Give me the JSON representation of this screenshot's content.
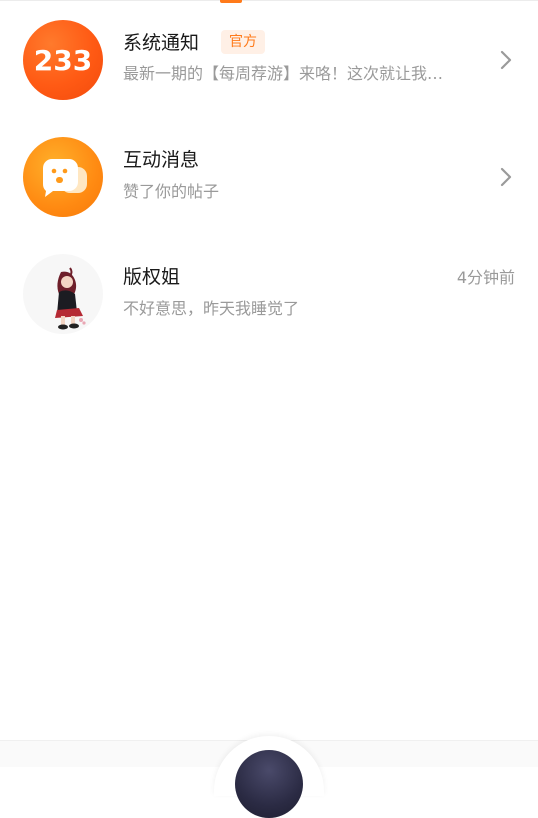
{
  "messages": [
    {
      "title": "系统通知",
      "badge": "官方",
      "subtitle": "最新一期的【每周荐游】来咯！这次就让我…",
      "avatar_text": "233",
      "avatar_icon": "233-logo-icon",
      "has_chevron": true
    },
    {
      "title": "互动消息",
      "subtitle": "赞了你的帖子",
      "avatar_icon": "chat-bubbles-icon",
      "has_chevron": true
    },
    {
      "title": "版权姐",
      "subtitle": "不好意思，昨天我睡觉了",
      "time": "4分钟前",
      "avatar_icon": "anime-girl-avatar"
    }
  ],
  "colors": {
    "accent": "#ff7a1a",
    "system_avatar": "#ff5a14",
    "interaction_avatar": "#ff8a12",
    "secondary_text": "#9a9a9a"
  }
}
